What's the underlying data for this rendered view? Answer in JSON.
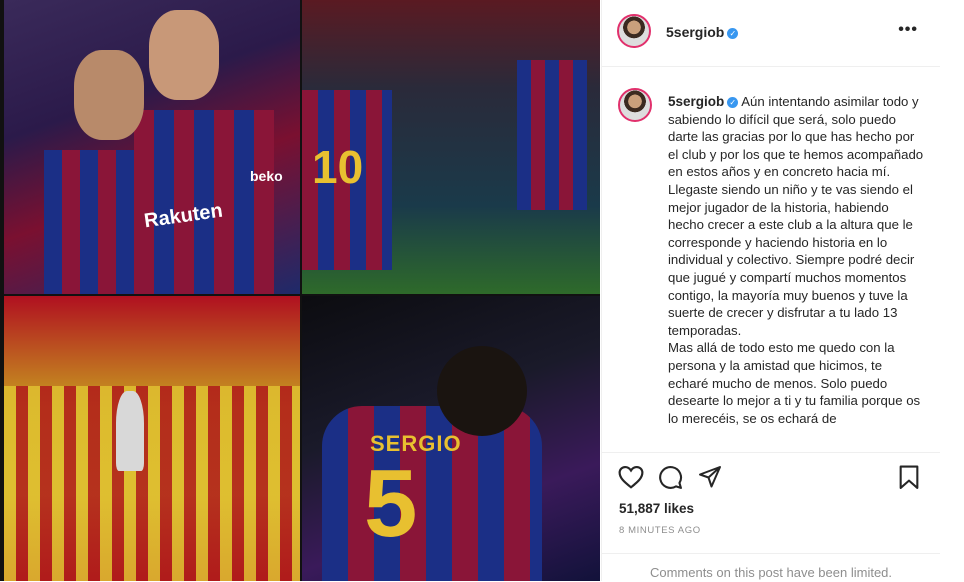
{
  "post": {
    "username": "5sergiob",
    "caption": "Aún intentando asimilar todo y sabiendo lo difícil que será, solo puedo darte las gracias por lo que has hecho por el club y por los que te hemos acompañado en estos años y en concreto hacia mí. Llegaste siendo un niño y te vas siendo el mejor jugador de la historia, habiendo hecho crecer a este club a la altura que le corresponde y haciendo historia en lo individual y colectivo. Siempre podré decir que jugué y compartí muchos momentos contigo, la mayoría muy buenos y tuve la suerte de crecer y disfrutar a tu lado 13 temporadas.\nMas allá de todo esto me quedo con la persona y la amistad que hicimos, te echaré mucho de menos. Solo puedo desearte lo mejor a ti y tu familia porque os lo merecéis, se os echará de",
    "likes": "51,887 likes",
    "time_ago": "8 MINUTES AGO",
    "comments_notice": "Comments on this post have been limited.",
    "more_label": "•••",
    "verified_mark": "✓"
  },
  "photos": {
    "jersey_name": "SERGIO",
    "jersey_number": "5",
    "shirt_number_2": "10",
    "sponsor": "Rakuten",
    "brand_logo": "beko"
  },
  "colors": {
    "verified": "#3897f0",
    "story_ring": "#e1306c",
    "muted": "#8e8e8e"
  },
  "icons": [
    "heart-icon",
    "comment-icon",
    "share-icon",
    "bookmark-icon",
    "more-options-icon",
    "verified-icon"
  ]
}
